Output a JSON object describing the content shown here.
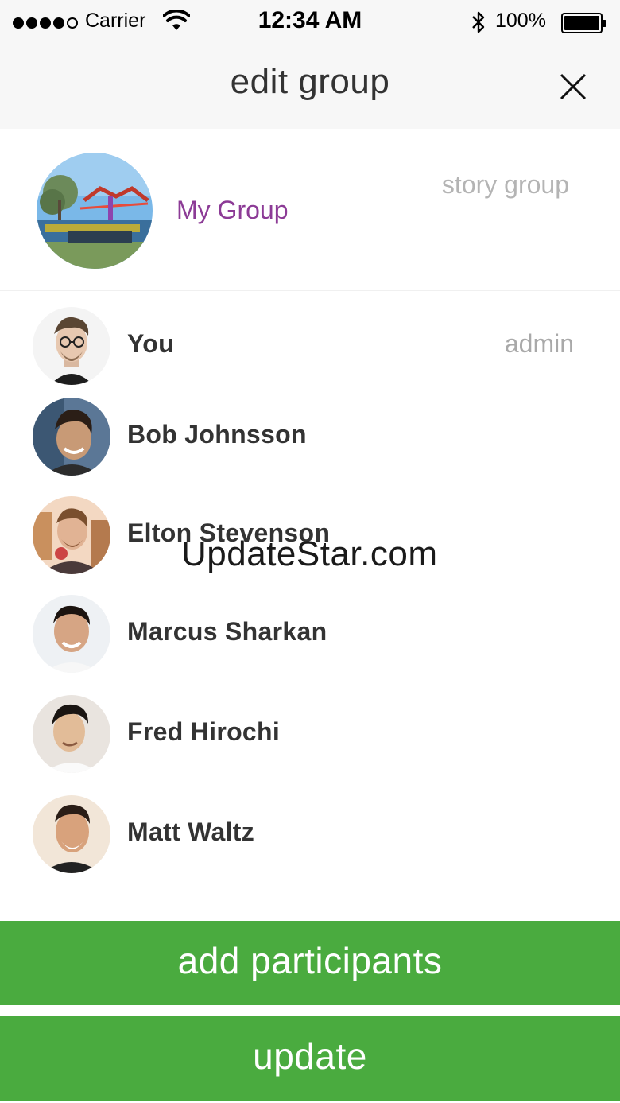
{
  "status_bar": {
    "carrier": "Carrier",
    "time": "12:34 AM",
    "battery": "100%"
  },
  "nav": {
    "title": "edit group",
    "close_icon": "close-icon"
  },
  "group": {
    "name": "My Group",
    "type": "story group"
  },
  "participants": [
    {
      "name": "You",
      "role": "admin"
    },
    {
      "name": "Bob Johnsson",
      "role": ""
    },
    {
      "name": "Elton Stevenson",
      "role": ""
    },
    {
      "name": "Marcus Sharkan",
      "role": ""
    },
    {
      "name": "Fred Hirochi",
      "role": ""
    },
    {
      "name": "Matt Waltz",
      "role": ""
    }
  ],
  "watermark": "UpdateStar.com",
  "buttons": {
    "add_participants": "add participants",
    "update": "update"
  },
  "colors": {
    "accent_green": "#4aab3f",
    "group_name_purple": "#8c3b96"
  }
}
